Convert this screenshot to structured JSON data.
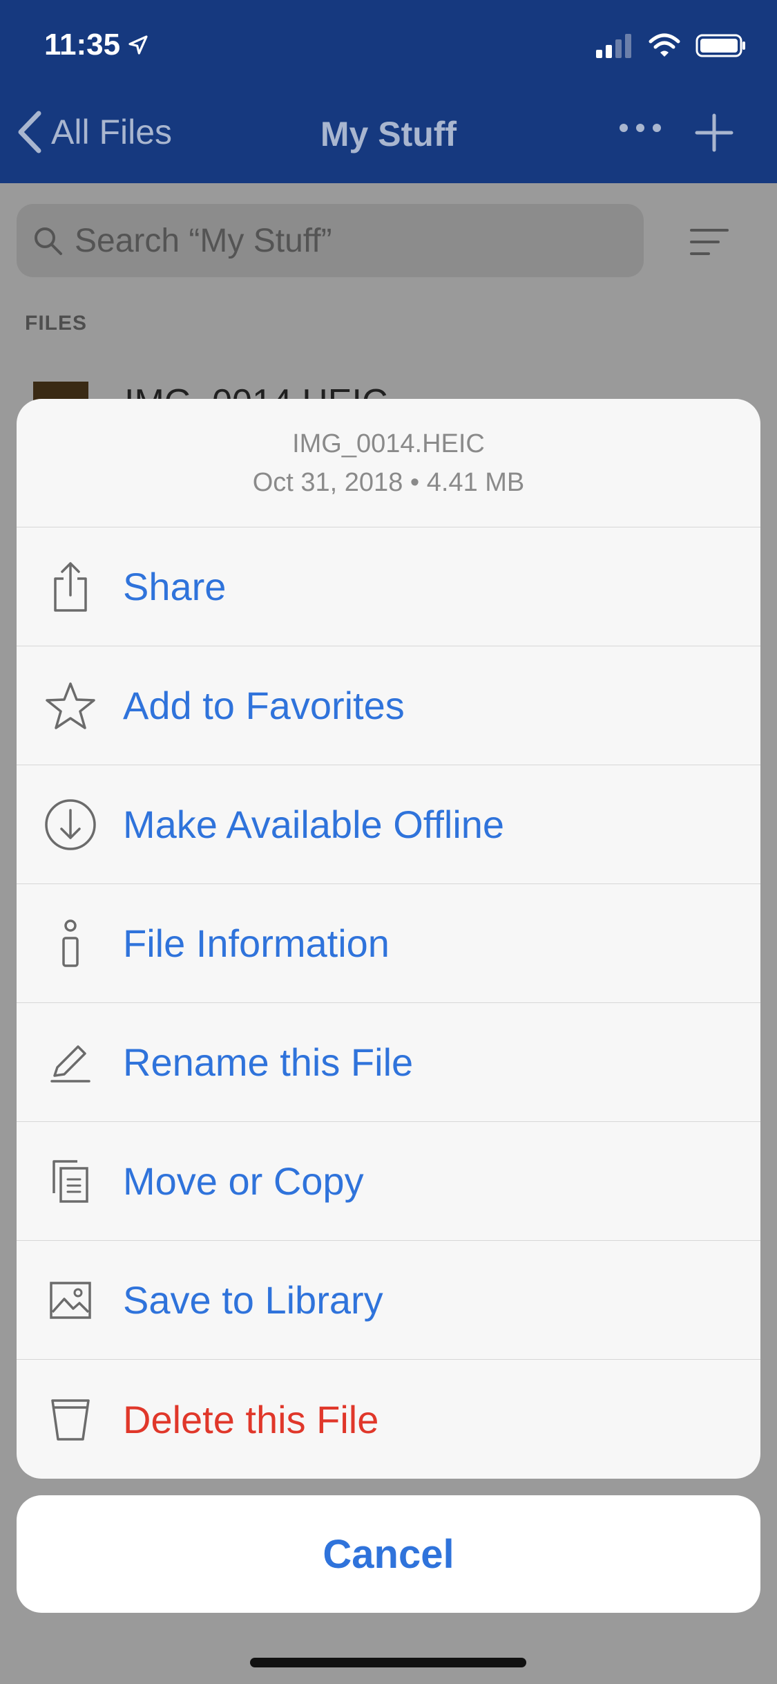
{
  "status_bar": {
    "time": "11:35"
  },
  "nav": {
    "back_label": "All Files",
    "title": "My Stuff"
  },
  "search": {
    "placeholder": "Search “My Stuff”"
  },
  "section": {
    "files_label": "FILES"
  },
  "background_file": {
    "name": "IMG_0014.HEIC"
  },
  "sheet": {
    "file_name": "IMG_0014.HEIC",
    "file_meta": "Oct 31, 2018 • 4.41 MB",
    "actions": [
      {
        "label": "Share",
        "icon": "share-icon"
      },
      {
        "label": "Add to Favorites",
        "icon": "star-icon"
      },
      {
        "label": "Make Available Offline",
        "icon": "download-circle-icon"
      },
      {
        "label": "File Information",
        "icon": "info-icon"
      },
      {
        "label": "Rename this File",
        "icon": "pencil-icon"
      },
      {
        "label": "Move or Copy",
        "icon": "copy-icon"
      },
      {
        "label": "Save to Library",
        "icon": "image-icon"
      },
      {
        "label": "Delete this File",
        "icon": "trash-icon"
      }
    ],
    "cancel_label": "Cancel"
  },
  "colors": {
    "header_bg": "#16397f",
    "action_blue": "#2f73db",
    "destructive_red": "#e0372a"
  }
}
